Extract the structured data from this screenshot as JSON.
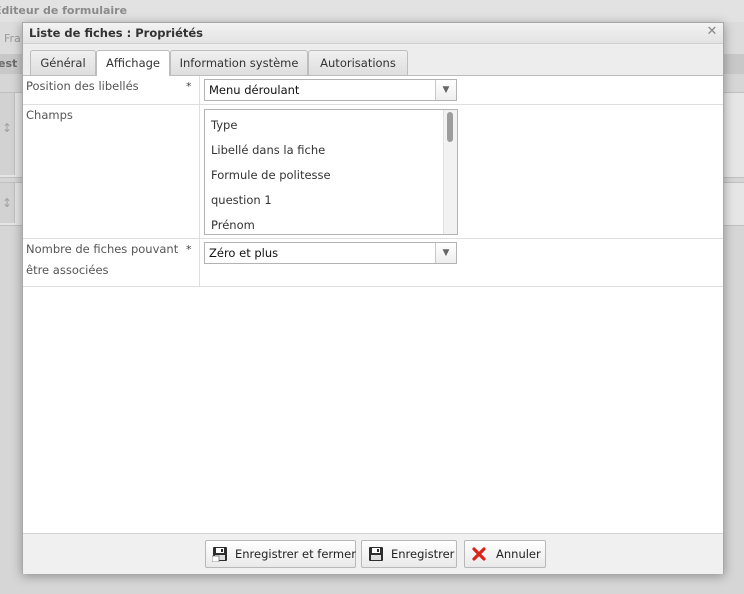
{
  "background": {
    "app_title": "Éditeur de formulaire",
    "toolbar_fragment": "Fra",
    "row_fragment": "est"
  },
  "dialog": {
    "title": "Liste de fiches : Propriétés",
    "tabs": [
      {
        "label": "Général"
      },
      {
        "label": "Affichage"
      },
      {
        "label": "Information système"
      },
      {
        "label": "Autorisations"
      }
    ],
    "active_tab": "Affichage",
    "fields": {
      "label_position": {
        "label": "Position des libellés",
        "required": "*",
        "value": "Menu déroulant"
      },
      "champs": {
        "label": "Champs",
        "items": [
          "Type",
          "Libellé dans la fiche",
          "Formule de politesse",
          "question 1",
          "Prénom"
        ]
      },
      "count": {
        "label_line1": "Nombre de fiches pouvant",
        "label_line2": "être associées",
        "required": "*",
        "value": "Zéro et plus"
      }
    },
    "buttons": {
      "save_close": "Enregistrer et fermer",
      "save": "Enregistrer",
      "cancel": "Annuler"
    }
  },
  "icons": {
    "close": "close-icon",
    "dropdown": "chevron-down-icon",
    "save": "floppy-icon",
    "cancel": "x-icon"
  },
  "colors": {
    "cancel_red": "#d9241c",
    "floppy_dark": "#2d2d2d"
  }
}
